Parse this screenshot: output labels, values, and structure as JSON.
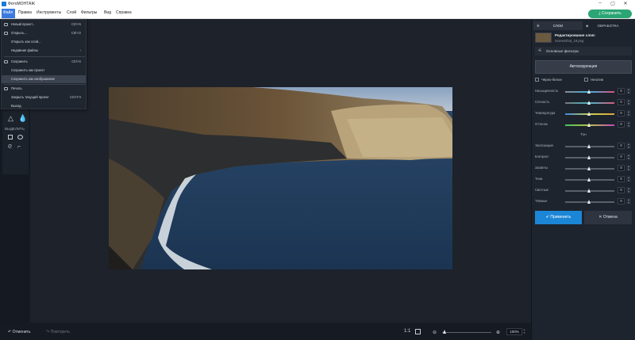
{
  "app": {
    "title": "ФотоМОНТАЖ"
  },
  "menu": [
    "Файл",
    "Правка",
    "Инструменты",
    "Слой",
    "Фильтры",
    "Вид",
    "Справка"
  ],
  "save_button": "Сохранить",
  "file_menu": [
    {
      "label": "Новый проект...",
      "shortcut": "Ctrl+N",
      "icon": "file-icon"
    },
    {
      "label": "Открыть...",
      "shortcut": "Ctrl+O",
      "icon": "folder-icon"
    },
    {
      "label": "Открыть как слой...",
      "shortcut": ""
    },
    {
      "label": "Недавние файлы",
      "shortcut": "›"
    },
    {
      "label": "Сохранить",
      "shortcut": "Ctrl+S",
      "icon": "save-icon"
    },
    {
      "label": "Сохранить как проект",
      "shortcut": ""
    },
    {
      "label": "Сохранить как изображение",
      "shortcut": ""
    },
    {
      "label": "Печать",
      "shortcut": "",
      "icon": "print-icon"
    },
    {
      "label": "Закрыть текущий проект",
      "shortcut": "Ctrl+F4"
    },
    {
      "label": "Выход",
      "shortcut": ""
    }
  ],
  "toolstrip": {
    "select_label": "ВЫДЕЛИТЬ"
  },
  "bottom": {
    "undo": "Отменить",
    "redo": "Повторить",
    "ratio": "1:1",
    "zoom": "100%"
  },
  "panel": {
    "tab_layers": "СЛОИ",
    "tab_processing": "ОБРАБОТКА",
    "layer_title": "Редактирование слоя:",
    "layer_file": "Screenshot_19.png",
    "filters_label": "Основные фильтры",
    "autocorrect": "Автокоррекция",
    "bw": "Чёрно-белое",
    "negative": "Негатив",
    "tone_label": "Тон",
    "apply": "Применить",
    "cancel": "Отмена",
    "sliders_color": [
      {
        "label": "Насыщенность",
        "value": "0"
      },
      {
        "label": "Сочность",
        "value": "0"
      },
      {
        "label": "Температура",
        "value": "0"
      },
      {
        "label": "Оттенок",
        "value": "0"
      }
    ],
    "sliders_tone": [
      {
        "label": "Экспозиция",
        "value": "0"
      },
      {
        "label": "Контраст",
        "value": "0"
      },
      {
        "label": "Засветы",
        "value": "0"
      },
      {
        "label": "Тени",
        "value": "0"
      },
      {
        "label": "Светлые",
        "value": "0"
      },
      {
        "label": "Тёмные",
        "value": "0"
      }
    ]
  },
  "colors": {
    "accent": "#1d7bd8",
    "save_green": "#2ba574",
    "apply_blue": "#1c86d6"
  }
}
